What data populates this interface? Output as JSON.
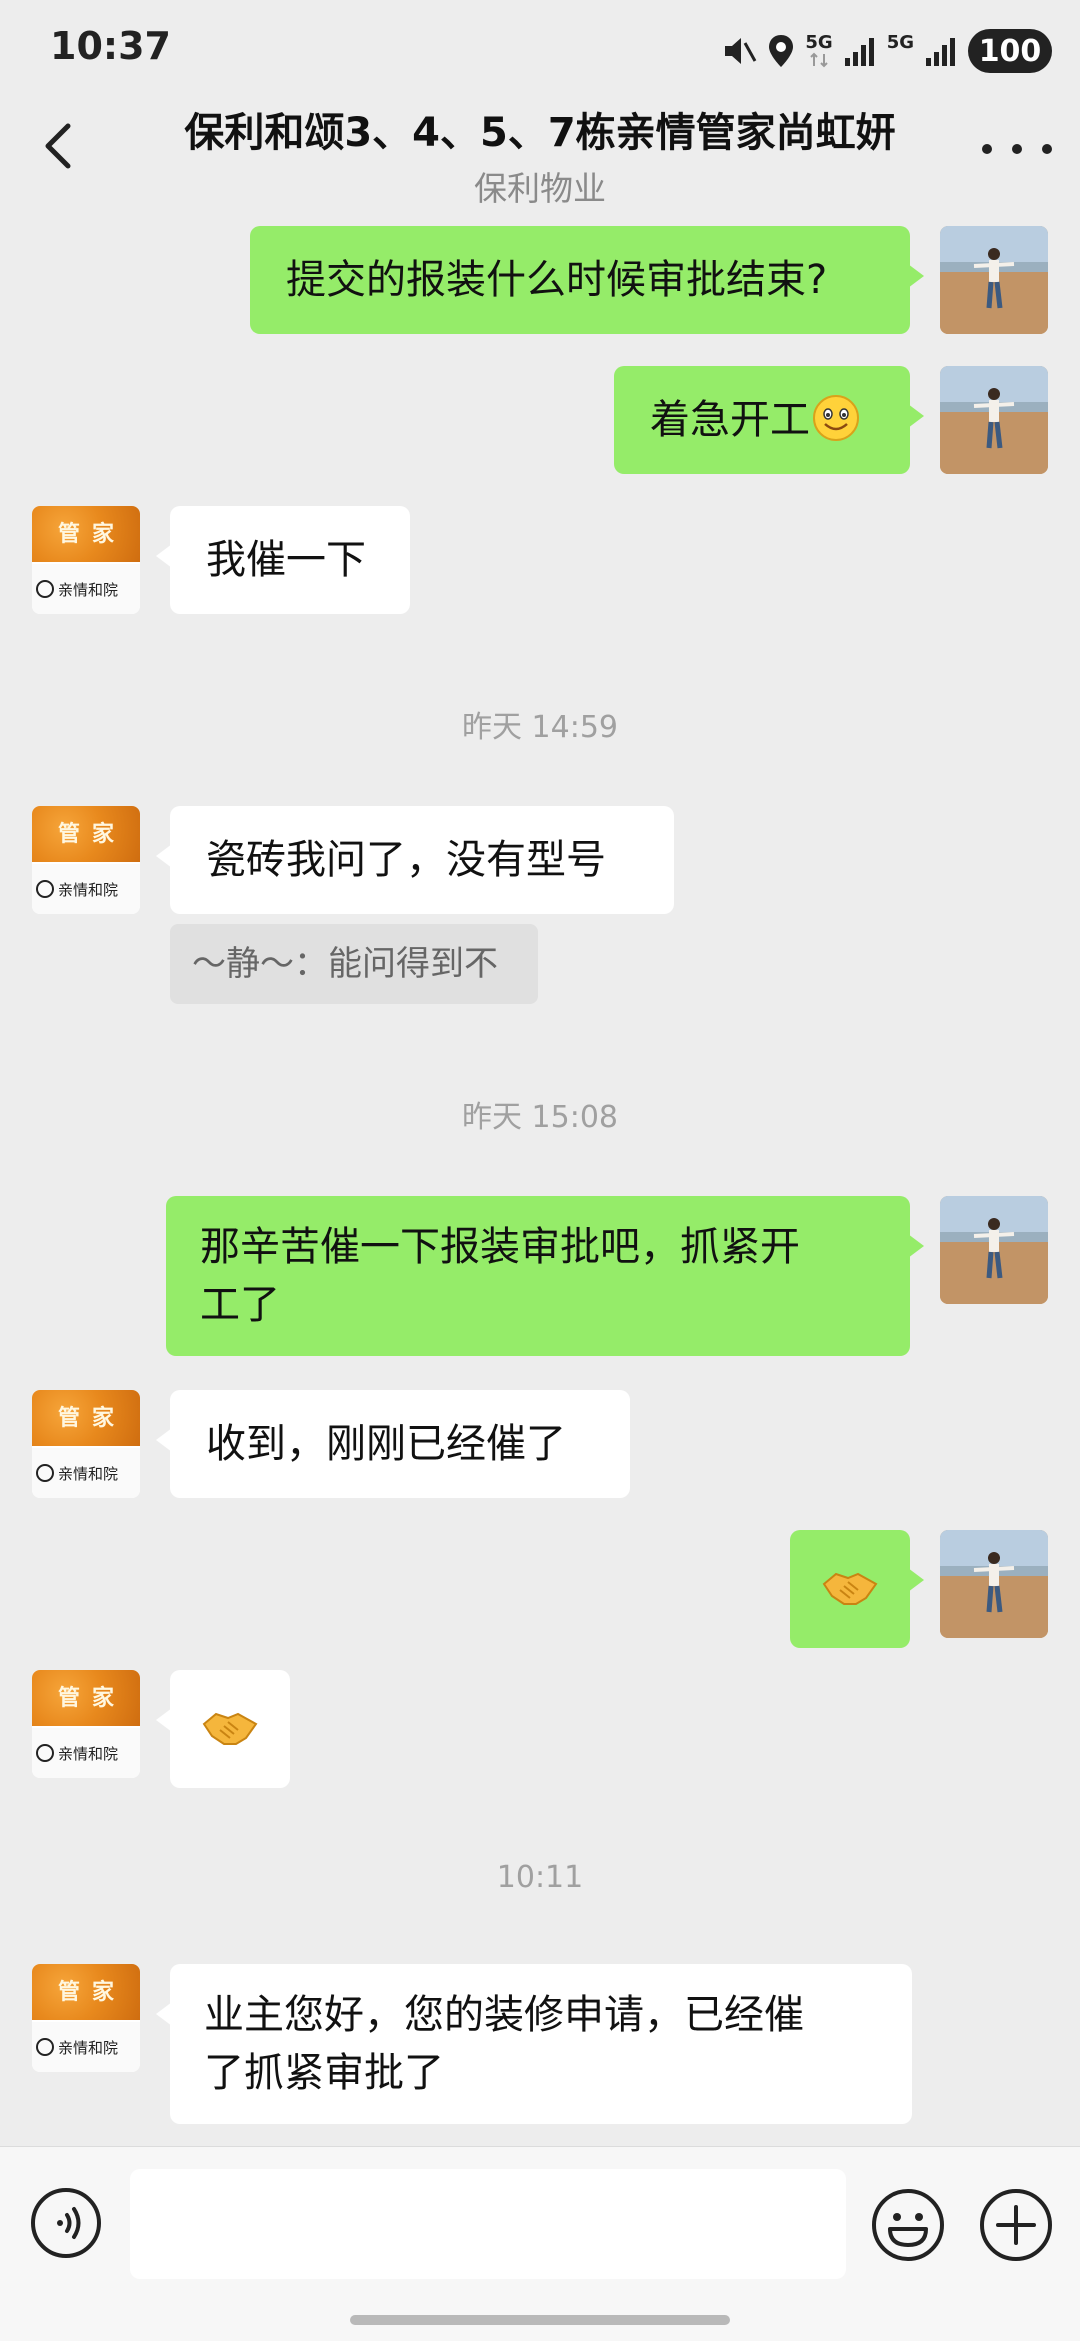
{
  "status_bar": {
    "time": "10:37",
    "net1": "5G",
    "net2": "5G",
    "battery": "100"
  },
  "header": {
    "title": "保利和颂3、4、5、7栋亲情管家尚虹妍",
    "subtitle": "保利物业"
  },
  "avatar": {
    "badge_text": "管家",
    "org_text": "亲情和院"
  },
  "messages": {
    "m1": {
      "sender": "me",
      "text": "提交的报装什么时候审批结束?"
    },
    "m2": {
      "sender": "me",
      "text": "着急开工",
      "emoji": "smile"
    },
    "m3": {
      "sender": "them",
      "text": "我催一下"
    },
    "ts1": "昨天 14:59",
    "m4": {
      "sender": "them",
      "text": "瓷砖我问了，没有型号"
    },
    "quote1": "～静～：能问得到不",
    "ts2": "昨天 15:08",
    "m5": {
      "sender": "me",
      "line1": "那辛苦催一下报装审批吧，抓紧开",
      "line2": "工了"
    },
    "m6": {
      "sender": "them",
      "text": "收到，刚刚已经催了"
    },
    "m7": {
      "sender": "me",
      "emoji": "handshake"
    },
    "m8": {
      "sender": "them",
      "emoji": "handshake"
    },
    "ts3": "10:11",
    "m9": {
      "sender": "them",
      "line1": "业主您好，您的装修申请，已经催",
      "line2": "了抓紧审批了"
    }
  },
  "input_bar": {
    "voice_icon": "voice-icon",
    "emoji_icon": "emoji-icon",
    "plus_icon": "plus-icon",
    "text": ""
  },
  "colors": {
    "my_bubble": "#95ec69",
    "their_bubble": "#ffffff",
    "background": "#ededed"
  }
}
